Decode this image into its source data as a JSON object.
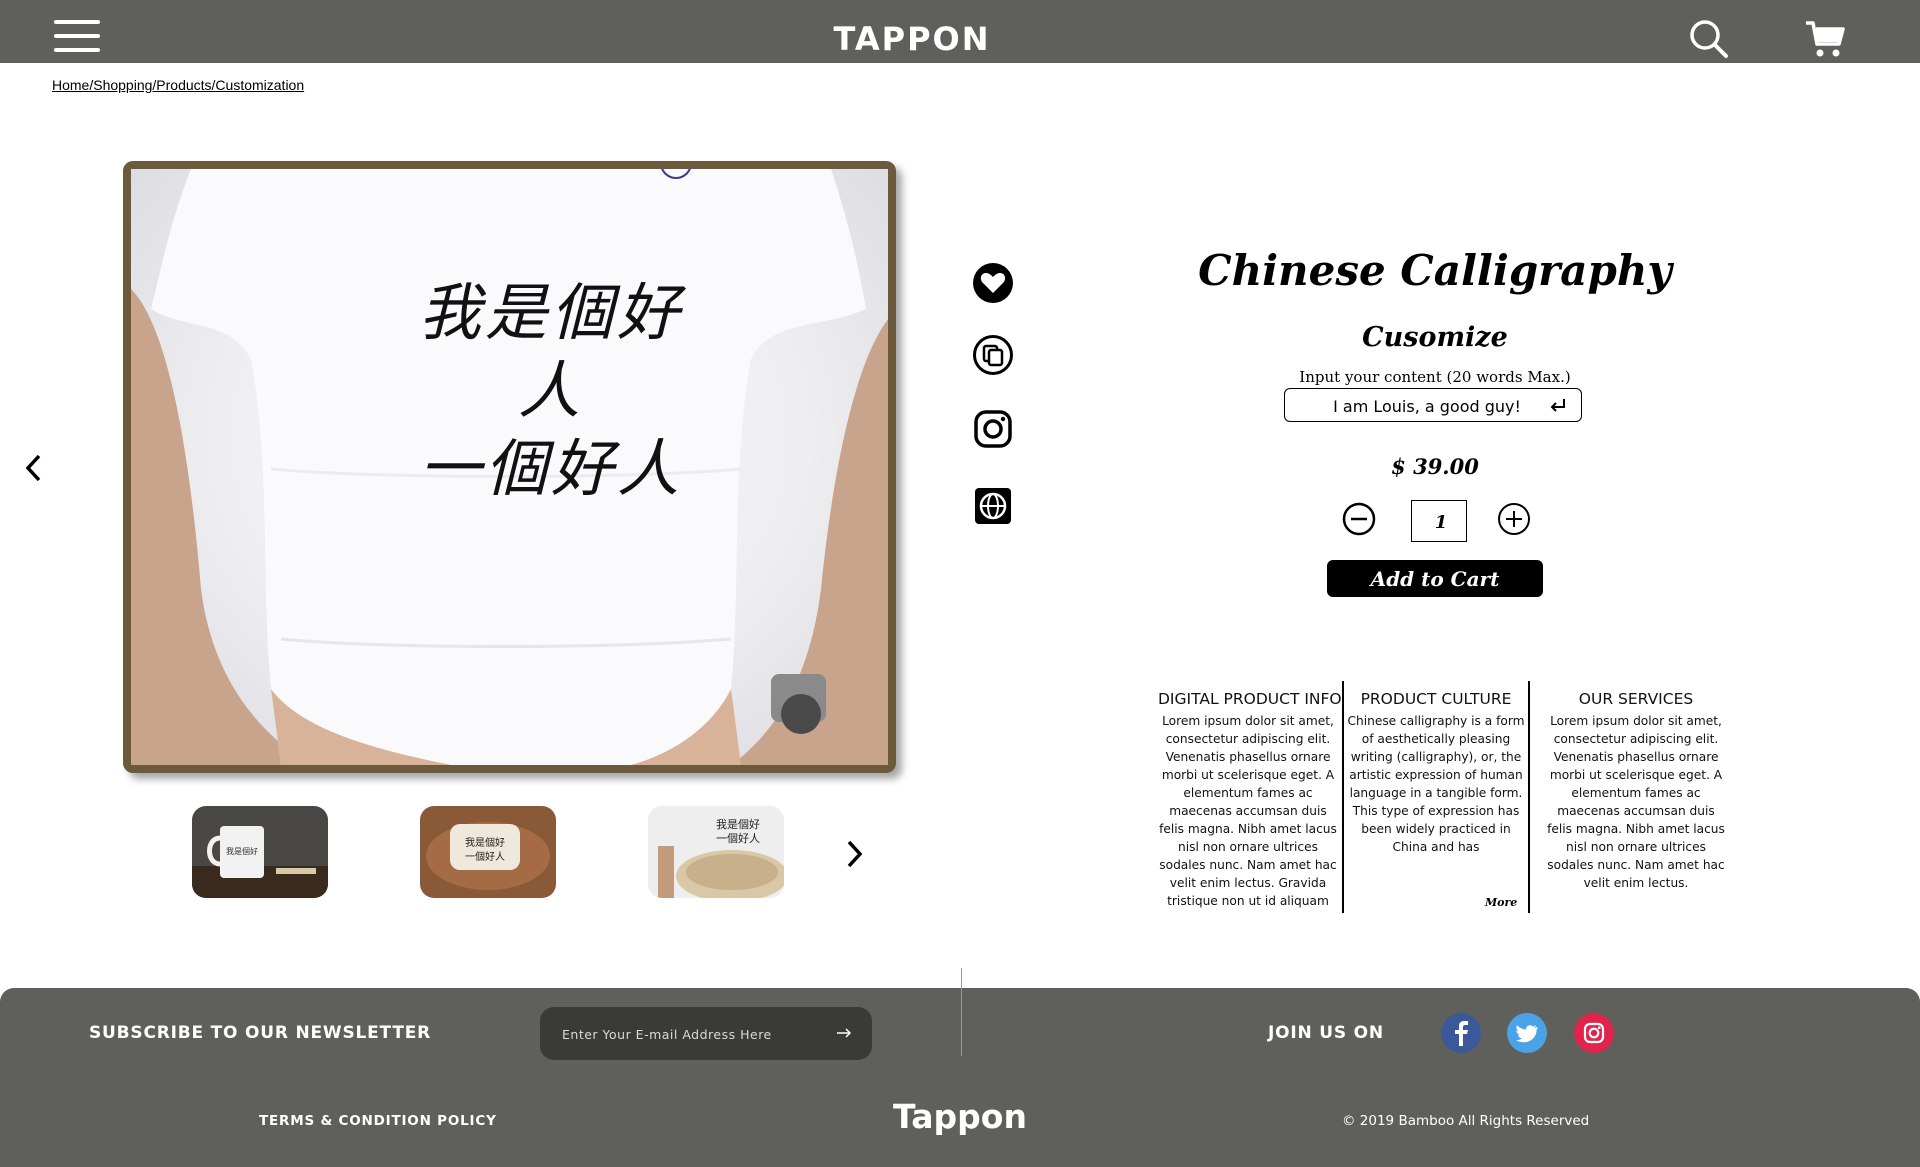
{
  "header": {
    "brand": "TAPPON",
    "menu_icon": "hamburger-menu-icon",
    "search_icon": "search-icon",
    "cart_icon": "shopping-cart-icon"
  },
  "breadcrumb": "Home/Shopping/Products/Customization",
  "gallery": {
    "main_image": "white t-shirt with chinese calligraphy",
    "calligraphy_line1": "我是個好人",
    "calligraphy_line2": "一個好人",
    "thumbnails": [
      "mug",
      "pillow",
      "bowl"
    ]
  },
  "product": {
    "title": "Chinese Calligraphy",
    "subtitle": "Cusomize",
    "input_label": "Input your content (20 words Max.)",
    "input_value": "I am Louis, a good guy!",
    "price": "$ 39.00",
    "quantity": "1",
    "add_to_cart": "Add to Cart"
  },
  "info": [
    {
      "heading": "DIGITAL PRODUCT INFO",
      "body": "Lorem ipsum dolor sit amet, consectetur adipiscing elit. Venenatis phasellus ornare morbi ut scelerisque eget. A elementum fames ac maecenas accumsan duis felis magna. Nibh amet lacus nisl non ornare ultrices sodales nunc. Nam amet hac velit enim lectus. Gravida tristique non ut id aliquam"
    },
    {
      "heading": "PRODUCT CULTURE",
      "body": "Chinese calligraphy is a form of aesthetically pleasing writing (calligraphy), or, the artistic expression of human language in a tangible form. This type of expression has been widely practiced in China and has",
      "more": "More"
    },
    {
      "heading": "OUR SERVICES",
      "body": "Lorem ipsum dolor sit amet, consectetur adipiscing elit. Venenatis phasellus ornare morbi ut scelerisque eget. A elementum fames ac maecenas accumsan duis felis magna. Nibh amet lacus nisl non ornare ultrices sodales nunc. Nam amet hac velit enim lectus."
    }
  ],
  "footer": {
    "newsletter_label": "SUBSCRIBE TO OUR NEWSLETTER",
    "newsletter_placeholder": "Enter Your E-mail Address Here",
    "join_label": "JOIN US ON",
    "terms": "TERMS & CONDITION POLICY",
    "brand": "Tappon",
    "copyright": "© 2019 Bamboo All Rights Reserved"
  },
  "colors": {
    "header_bg": "#5f605c",
    "frame": "#6b5a3c",
    "facebook": "#3b5998",
    "twitter": "#4aa3e8",
    "instagram": "#e0244c"
  }
}
